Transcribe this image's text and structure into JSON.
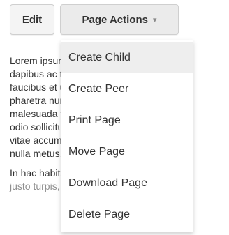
{
  "toolbar": {
    "edit_label": "Edit",
    "actions_label": "Page Actions",
    "actions_caret": "▾"
  },
  "content": {
    "paragraph1_lines": [
      "Lorem ipsum dolor sit amet, conse",
      "dapibus ac tincidunt nec, rutrum rem.",
      "faucibus et ultrices posuere commo",
      "pharetra nunc vitae tempor auctor ali",
      "malesuada fames ac turpis egestat. In r",
      "odio sollicitudin quis cursus sed, com",
      "vitae accumsan magna sem in. Prae",
      "nulla metus, feugiat sed imperdiet sod"
    ],
    "paragraph2_lines": [
      "In hac habitasse platea dictumst. I",
      "justo turpis, tristique imperdiet fau"
    ]
  },
  "menu": {
    "items": [
      {
        "label": "Create Child"
      },
      {
        "label": "Create Peer"
      },
      {
        "label": "Print Page"
      },
      {
        "label": "Move Page"
      },
      {
        "label": "Download Page"
      },
      {
        "label": "Delete Page"
      }
    ]
  }
}
